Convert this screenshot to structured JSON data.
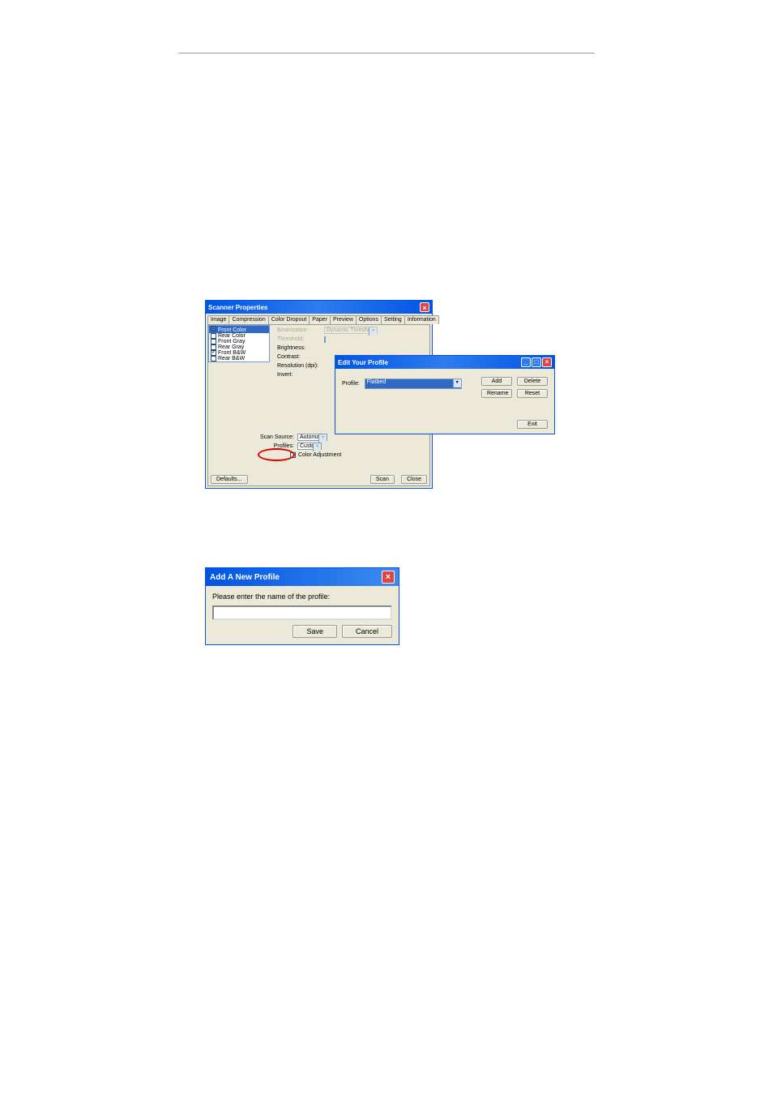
{
  "scanner": {
    "title": "Scanner Properties",
    "tabs": [
      "Image",
      "Compression",
      "Color Dropout",
      "Paper",
      "Preview",
      "Options",
      "Setting",
      "Information"
    ],
    "image_selection": {
      "header": "Front Color",
      "items": [
        "Rear Color",
        "Front Gray",
        "Rear Gray",
        "Front B&W",
        "Rear B&W"
      ],
      "checked_index": 3
    },
    "controls": {
      "binarization_label": "Binarization:",
      "binarization_value": "Dynamic Threshold",
      "threshold_label": "Threshold:",
      "brightness_label": "Brightness:",
      "contrast_label": "Contrast:",
      "resolution_label": "Resolution (dpi):",
      "invert_label": "Invert:"
    },
    "scan_source_label": "Scan Source:",
    "scan_source_value": "Automatic",
    "profiles_label": "Profiles:",
    "profiles_value": "Custom",
    "color_adjust_label": "Color Adjustment",
    "defaults_btn": "Defaults...",
    "scan_btn": "Scan",
    "close_btn": "Close"
  },
  "edit_profile": {
    "title": "Edit Your Profile",
    "profile_label": "Profile:",
    "profile_value": "Flatbed",
    "add_btn": "Add",
    "delete_btn": "Delete",
    "rename_btn": "Rename",
    "reset_btn": "Reset",
    "exit_btn": "Exit"
  },
  "add_profile": {
    "title": "Add A New Profile",
    "prompt": "Please enter the name of the profile:",
    "save_btn": "Save",
    "cancel_btn": "Cancel"
  }
}
